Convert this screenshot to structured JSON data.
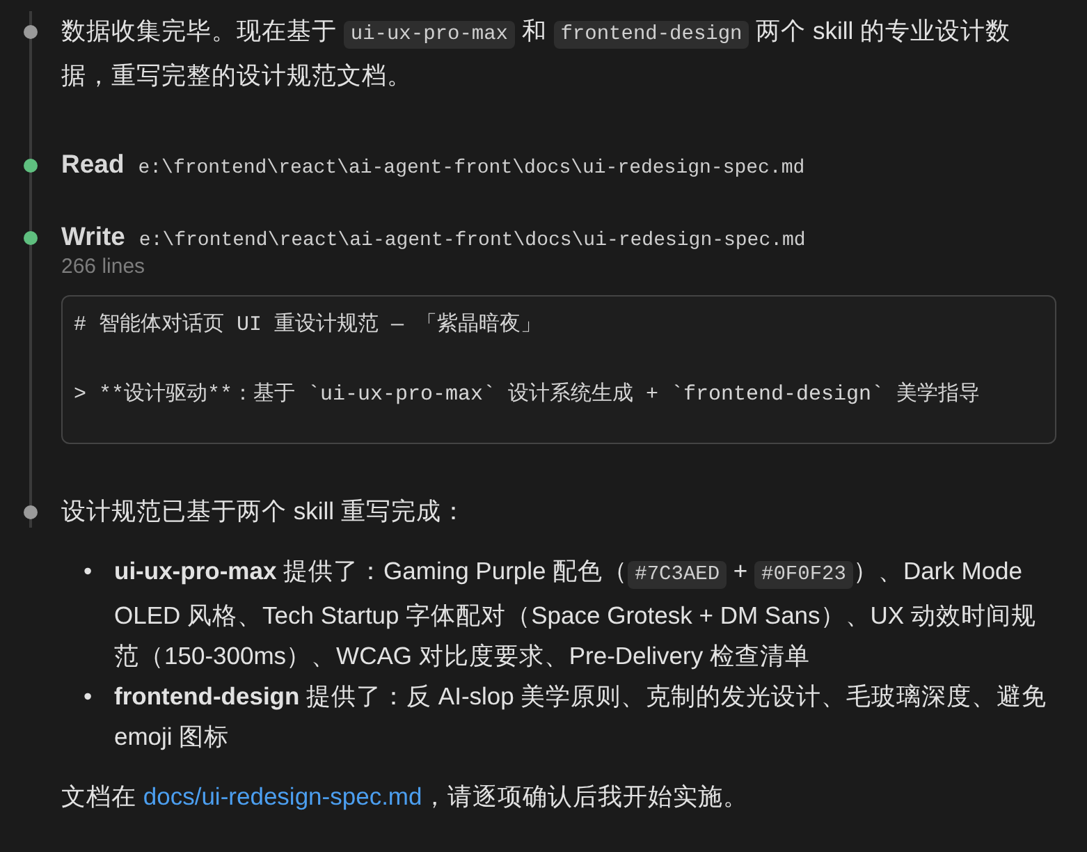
{
  "timeline": [
    {
      "kind": "text",
      "color": "#9a9a9a",
      "blocks": [
        {
          "kind": "paragraph",
          "parts": [
            {
              "kind": "plain",
              "text": "数据收集完毕。现在基于 "
            },
            {
              "kind": "code",
              "text": "ui-ux-pro-max"
            },
            {
              "kind": "plain",
              "text": " 和 "
            },
            {
              "kind": "code",
              "text": "frontend-design"
            },
            {
              "kind": "plain",
              "text": " 两个 skill 的专业设计数据，重写完整的设计规范文档。"
            }
          ]
        }
      ]
    },
    {
      "kind": "tool",
      "color": "#5fbf7f",
      "action": "Read",
      "path": "e:\\frontend\\react\\ai-agent-front\\docs\\ui-redesign-spec.md"
    },
    {
      "kind": "tool",
      "color": "#5fbf7f",
      "action": "Write",
      "path": "e:\\frontend\\react\\ai-agent-front\\docs\\ui-redesign-spec.md",
      "meta": "266 lines",
      "code_lines": [
        "# 智能体对话页 UI 重设计规范 — 「紫晶暗夜」",
        "> **设计驱动**：基于 `ui-ux-pro-max` 设计系统生成 + `frontend-design` 美学指导"
      ]
    },
    {
      "kind": "text",
      "color": "#9a9a9a",
      "blocks": [
        {
          "kind": "paragraph",
          "parts": [
            {
              "kind": "plain",
              "text": "设计规范已基于两个 skill 重写完成："
            }
          ]
        },
        {
          "kind": "bullets",
          "items": [
            {
              "marker": "•",
              "parts": [
                {
                  "kind": "bold",
                  "text": "ui-ux-pro-max"
                },
                {
                  "kind": "plain",
                  "text": " 提供了：Gaming Purple 配色（"
                },
                {
                  "kind": "code",
                  "text": "#7C3AED"
                },
                {
                  "kind": "plain",
                  "text": " + "
                },
                {
                  "kind": "code",
                  "text": "#0F0F23"
                },
                {
                  "kind": "plain",
                  "text": "）、Dark Mode OLED 风格、Tech Startup 字体配对（Space Grotesk + DM Sans）、UX 动效时间规范（150-300ms）、WCAG 对比度要求、Pre-Delivery 检查清单"
                }
              ]
            },
            {
              "marker": "•",
              "parts": [
                {
                  "kind": "bold",
                  "text": "frontend-design"
                },
                {
                  "kind": "plain",
                  "text": " 提供了：反 AI-slop 美学原则、克制的发光设计、毛玻璃深度、避免 emoji 图标"
                }
              ]
            }
          ]
        },
        {
          "kind": "paragraph",
          "parts": [
            {
              "kind": "plain",
              "text": "文档在 "
            },
            {
              "kind": "link",
              "text": "docs/ui-redesign-spec.md"
            },
            {
              "kind": "plain",
              "text": "，请逐项确认后我开始实施。"
            }
          ]
        }
      ]
    }
  ]
}
